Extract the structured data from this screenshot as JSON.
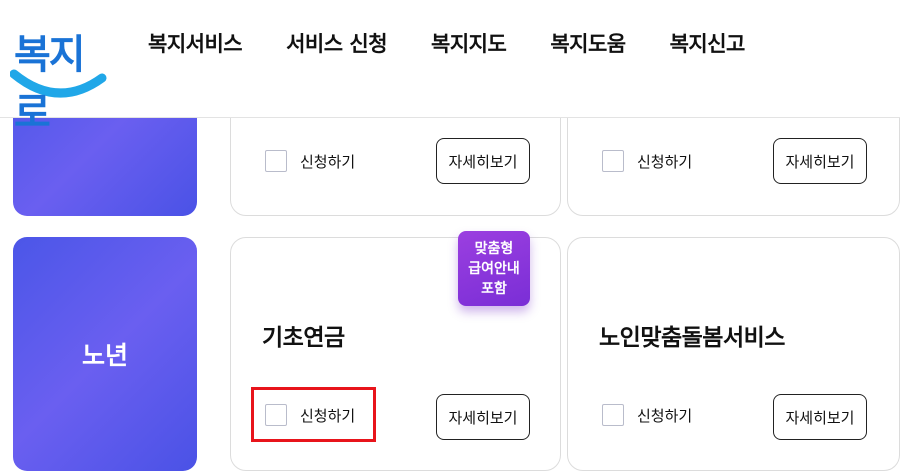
{
  "header": {
    "logo_text": "복지로",
    "nav": [
      "복지서비스",
      "서비스 신청",
      "복지지도",
      "복지도움",
      "복지신고"
    ]
  },
  "categories": {
    "top": "",
    "main": "노년"
  },
  "top_row": {
    "card1": {
      "apply_label": "신청하기",
      "detail_label": "자세히보기"
    },
    "card2": {
      "apply_label": "신청하기",
      "detail_label": "자세히보기"
    }
  },
  "services": [
    {
      "title": "기초연금",
      "badge": [
        "맞춤형",
        "급여안내",
        "포함"
      ],
      "apply_label": "신청하기",
      "detail_label": "자세히보기"
    },
    {
      "title": "노인맞춤돌봄서비스",
      "apply_label": "신청하기",
      "detail_label": "자세히보기"
    }
  ],
  "colors": {
    "brand_blue": "#1a73d6",
    "tile_gradient_start": "#4b56e8",
    "badge_purple": "#8a35dc",
    "highlight_red": "#e8141b"
  }
}
